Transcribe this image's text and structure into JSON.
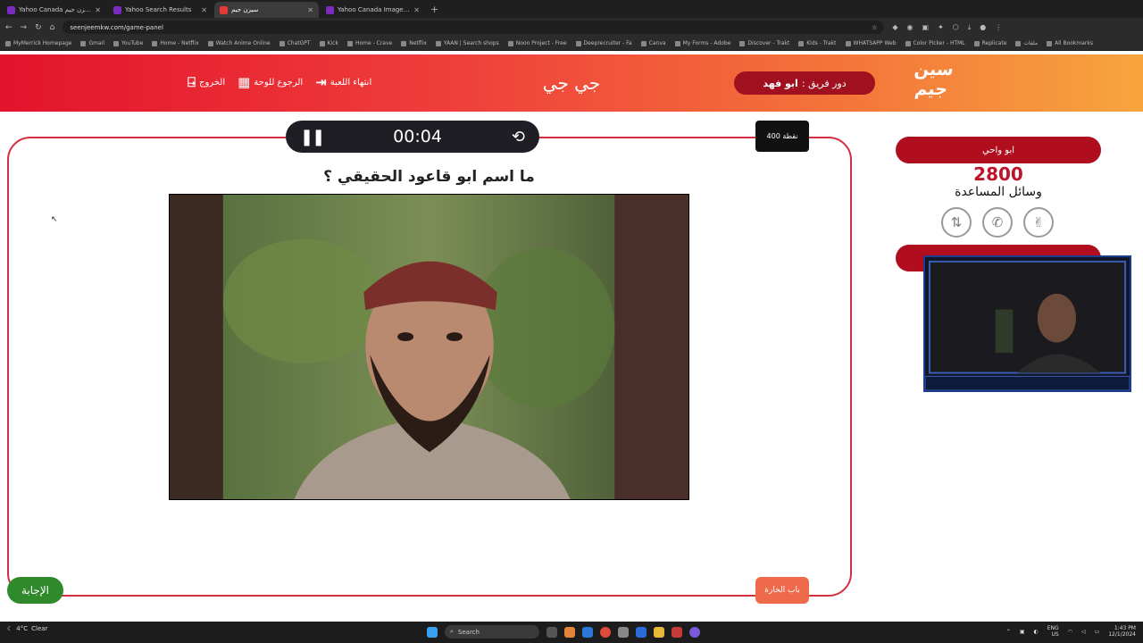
{
  "browser": {
    "tabs": [
      {
        "title": "Yahoo Canada سيزن جيم"
      },
      {
        "title": "Yahoo Search Results"
      },
      {
        "title": "سيزن جيم"
      },
      {
        "title": "Yahoo Canada Image Search"
      }
    ],
    "active_tab": 2,
    "url": "seenjeemkw.com/game-panel",
    "bookmarks": [
      "MyMerrick Homepage",
      "Gmail",
      "YouTube",
      "Home - Netflix",
      "Watch Anime Online",
      "ChatGPT",
      "Kick",
      "Home - Crave",
      "Netflix",
      "YAAN | Search shops",
      "Noon Project - Free",
      "Deeprecruiter - Fa",
      "Canva",
      "My Forms - Adobe",
      "Discover - Trakt",
      "Kids - Trakt",
      "WHATSAPP Web",
      "Color Picker - HTML",
      "Replicate",
      "ملفات",
      "All Bookmarks"
    ]
  },
  "header": {
    "logo_line1": "سين",
    "logo_line2": "جيم",
    "turn_prefix": "دور فريق :",
    "turn_team": "ابو فهد",
    "game_name": "جي جي",
    "nav": {
      "end_game": "انتهاء اللعبة",
      "back_to_board": "الرجوع للوحة",
      "exit": "الخروج"
    }
  },
  "question": {
    "timer": "00:04",
    "points_label": "400 نقطة",
    "text": "ما اسم ابو قاعود الحقيقي ؟",
    "category": "باب الحارة",
    "answer_button": "الإجابة"
  },
  "sidebar": {
    "team1_name": "ابو واحي",
    "team1_score": "2800",
    "aids_title": "وسائل المساعدة",
    "aids": [
      "two-answers-icon",
      "call-icon",
      "swap-icon"
    ]
  },
  "taskbar": {
    "weather_temp": "4°C",
    "weather_desc": "Clear",
    "search_placeholder": "Search",
    "lang": "ENG",
    "lang_sub": "US",
    "time": "1:43 PM",
    "date": "12/1/2024"
  },
  "colors": {
    "brand_red": "#e3132b",
    "brand_orange": "#f7a53e",
    "team_pill": "#b00e1f",
    "answer_green": "#2f8a2c",
    "category_orange": "#ef6a4b"
  }
}
